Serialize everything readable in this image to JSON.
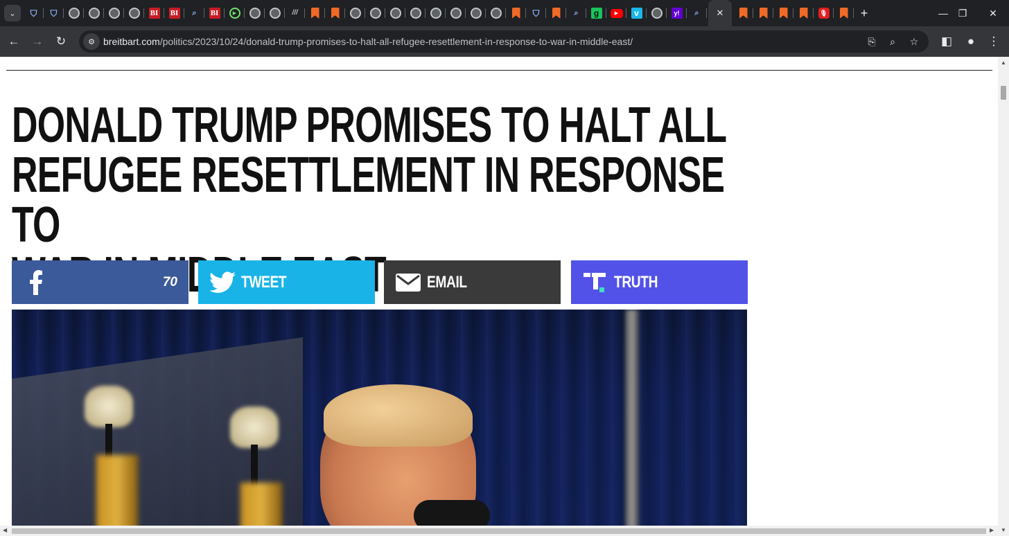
{
  "browser": {
    "tabs": [
      {
        "icon": "shield-icon"
      },
      {
        "icon": "shield-icon"
      },
      {
        "icon": "globe-icon"
      },
      {
        "icon": "globe-icon"
      },
      {
        "icon": "globe-icon"
      },
      {
        "icon": "globe-icon"
      },
      {
        "icon": "business-insider-icon",
        "text": "BI"
      },
      {
        "icon": "business-insider-icon",
        "text": "BI"
      },
      {
        "icon": "search-icon"
      },
      {
        "icon": "business-insider-icon",
        "text": "BI"
      },
      {
        "icon": "rumble-play-icon"
      },
      {
        "icon": "globe-icon"
      },
      {
        "icon": "globe-icon"
      },
      {
        "icon": "slash-icon",
        "text": "///"
      },
      {
        "icon": "bookmark-ribbon-icon"
      },
      {
        "icon": "bookmark-ribbon-icon"
      },
      {
        "icon": "globe-icon"
      },
      {
        "icon": "globe-icon"
      },
      {
        "icon": "globe-icon"
      },
      {
        "icon": "globe-icon"
      },
      {
        "icon": "globe-icon"
      },
      {
        "icon": "globe-icon"
      },
      {
        "icon": "globe-icon"
      },
      {
        "icon": "globe-icon"
      },
      {
        "icon": "bookmark-ribbon-icon"
      },
      {
        "icon": "shield-icon"
      },
      {
        "icon": "bookmark-ribbon-icon"
      },
      {
        "icon": "search-icon"
      },
      {
        "icon": "g-icon",
        "text": "g"
      },
      {
        "icon": "youtube-icon",
        "text": "▶"
      },
      {
        "icon": "vimeo-icon",
        "text": "v"
      },
      {
        "icon": "globe-icon"
      },
      {
        "icon": "yahoo-icon",
        "text": "y!"
      },
      {
        "icon": "search-icon"
      }
    ],
    "tabs_after": [
      {
        "icon": "bookmark-ribbon-icon"
      },
      {
        "icon": "bookmark-ribbon-icon"
      },
      {
        "icon": "bookmark-ribbon-icon"
      },
      {
        "icon": "bookmark-ribbon-icon"
      },
      {
        "icon": "podcast-icon",
        "text": "🎙"
      },
      {
        "icon": "bookmark-ribbon-icon"
      }
    ],
    "url_host": "breitbart.com",
    "url_path": "/politics/2023/10/24/donald-trump-promises-to-halt-all-refugee-resettlement-in-response-to-war-in-middle-east/"
  },
  "article": {
    "headline_lines": [
      "DONALD TRUMP PROMISES TO HALT ALL",
      "REFUGEE RESETTLEMENT IN RESPONSE TO",
      "WAR IN MIDDLE EAST"
    ],
    "share": {
      "facebook_count": "70",
      "tweet_label": "TWEET",
      "email_label": "EMAIL",
      "truth_label": "TRUTH"
    },
    "colors": {
      "facebook": "#3b5a9a",
      "twitter": "#1ab3e7",
      "email": "#3a3a3a",
      "truth": "#5252e8"
    }
  }
}
